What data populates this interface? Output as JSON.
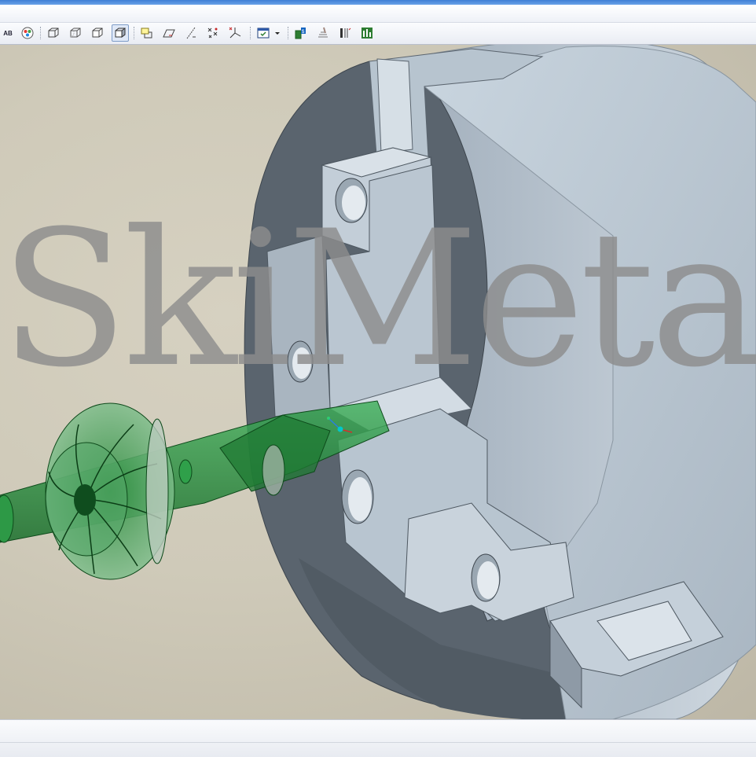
{
  "window": {
    "accent": "#3f7fd6"
  },
  "toolbar": {
    "items": [
      {
        "icon": "annotation-display-icon",
        "label": "AB"
      },
      {
        "icon": "appearance-gallery-icon"
      },
      {
        "icon": "wireframe-icon"
      },
      {
        "icon": "hidden-line-icon"
      },
      {
        "icon": "no-hidden-icon"
      },
      {
        "icon": "shading-icon",
        "active": true
      },
      {
        "icon": "datum-planes-display-icon"
      },
      {
        "icon": "datum-planes-tag-icon"
      },
      {
        "icon": "datum-axes-display-icon"
      },
      {
        "icon": "datum-points-display-icon"
      },
      {
        "icon": "coordinate-systems-display-icon"
      },
      {
        "icon": "saved-views-icon"
      },
      {
        "icon": "view-manager-dropdown-icon"
      },
      {
        "icon": "mfg-setup-icon"
      },
      {
        "icon": "mfg-operation-icon"
      },
      {
        "icon": "mfg-cutline-icon"
      },
      {
        "icon": "mfg-sequence-icon"
      }
    ]
  },
  "viewport": {
    "background": "#cfcab9",
    "model_color": "#1c8a33",
    "chuck_color": "#c6d2dd"
  },
  "watermark": {
    "text": "SkiMeta"
  }
}
